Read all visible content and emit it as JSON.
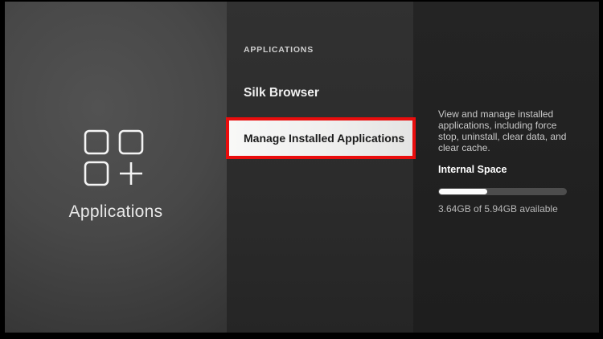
{
  "left_panel": {
    "label": "Applications",
    "icon": "apps-grid-plus-icon"
  },
  "menu": {
    "header": "APPLICATIONS",
    "items": [
      {
        "label": "Silk Browser",
        "selected": false
      },
      {
        "label": "Manage Installed Applications",
        "selected": true,
        "annotated": true
      }
    ]
  },
  "detail": {
    "description_lines": [
      "View and manage installed",
      "applications, including force",
      "stop, uninstall, clear data, and",
      "clear cache."
    ],
    "storage": {
      "title": "Internal Space",
      "used_percent": 38,
      "available_text": "3.64GB of 5.94GB available"
    }
  },
  "colors": {
    "annotation_red": "#e90d0d",
    "progress_track": "#4d4d4d",
    "progress_fill": "#fdfdfd",
    "highlight_bg": "#f2f2f0"
  }
}
